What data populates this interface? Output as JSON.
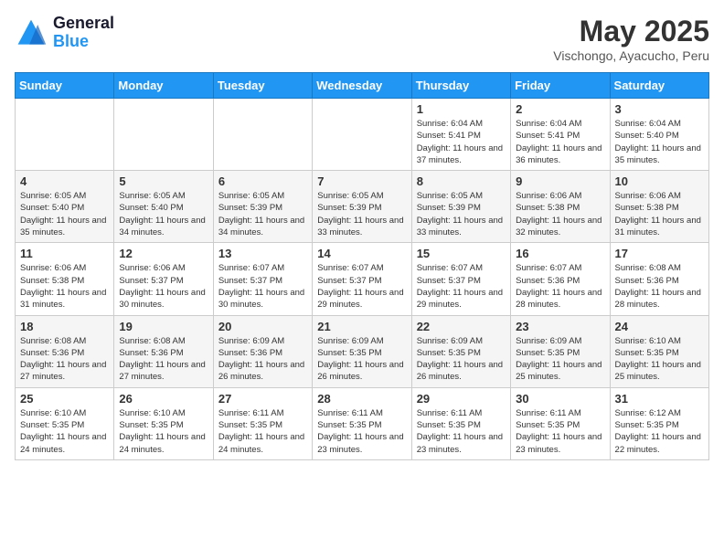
{
  "logo": {
    "text_general": "General",
    "text_blue": "Blue"
  },
  "title": "May 2025",
  "subtitle": "Vischongo, Ayacucho, Peru",
  "days_of_week": [
    "Sunday",
    "Monday",
    "Tuesday",
    "Wednesday",
    "Thursday",
    "Friday",
    "Saturday"
  ],
  "weeks": [
    [
      {
        "day": "",
        "info": ""
      },
      {
        "day": "",
        "info": ""
      },
      {
        "day": "",
        "info": ""
      },
      {
        "day": "",
        "info": ""
      },
      {
        "day": "1",
        "info": "Sunrise: 6:04 AM\nSunset: 5:41 PM\nDaylight: 11 hours and 37 minutes."
      },
      {
        "day": "2",
        "info": "Sunrise: 6:04 AM\nSunset: 5:41 PM\nDaylight: 11 hours and 36 minutes."
      },
      {
        "day": "3",
        "info": "Sunrise: 6:04 AM\nSunset: 5:40 PM\nDaylight: 11 hours and 35 minutes."
      }
    ],
    [
      {
        "day": "4",
        "info": "Sunrise: 6:05 AM\nSunset: 5:40 PM\nDaylight: 11 hours and 35 minutes."
      },
      {
        "day": "5",
        "info": "Sunrise: 6:05 AM\nSunset: 5:40 PM\nDaylight: 11 hours and 34 minutes."
      },
      {
        "day": "6",
        "info": "Sunrise: 6:05 AM\nSunset: 5:39 PM\nDaylight: 11 hours and 34 minutes."
      },
      {
        "day": "7",
        "info": "Sunrise: 6:05 AM\nSunset: 5:39 PM\nDaylight: 11 hours and 33 minutes."
      },
      {
        "day": "8",
        "info": "Sunrise: 6:05 AM\nSunset: 5:39 PM\nDaylight: 11 hours and 33 minutes."
      },
      {
        "day": "9",
        "info": "Sunrise: 6:06 AM\nSunset: 5:38 PM\nDaylight: 11 hours and 32 minutes."
      },
      {
        "day": "10",
        "info": "Sunrise: 6:06 AM\nSunset: 5:38 PM\nDaylight: 11 hours and 31 minutes."
      }
    ],
    [
      {
        "day": "11",
        "info": "Sunrise: 6:06 AM\nSunset: 5:38 PM\nDaylight: 11 hours and 31 minutes."
      },
      {
        "day": "12",
        "info": "Sunrise: 6:06 AM\nSunset: 5:37 PM\nDaylight: 11 hours and 30 minutes."
      },
      {
        "day": "13",
        "info": "Sunrise: 6:07 AM\nSunset: 5:37 PM\nDaylight: 11 hours and 30 minutes."
      },
      {
        "day": "14",
        "info": "Sunrise: 6:07 AM\nSunset: 5:37 PM\nDaylight: 11 hours and 29 minutes."
      },
      {
        "day": "15",
        "info": "Sunrise: 6:07 AM\nSunset: 5:37 PM\nDaylight: 11 hours and 29 minutes."
      },
      {
        "day": "16",
        "info": "Sunrise: 6:07 AM\nSunset: 5:36 PM\nDaylight: 11 hours and 28 minutes."
      },
      {
        "day": "17",
        "info": "Sunrise: 6:08 AM\nSunset: 5:36 PM\nDaylight: 11 hours and 28 minutes."
      }
    ],
    [
      {
        "day": "18",
        "info": "Sunrise: 6:08 AM\nSunset: 5:36 PM\nDaylight: 11 hours and 27 minutes."
      },
      {
        "day": "19",
        "info": "Sunrise: 6:08 AM\nSunset: 5:36 PM\nDaylight: 11 hours and 27 minutes."
      },
      {
        "day": "20",
        "info": "Sunrise: 6:09 AM\nSunset: 5:36 PM\nDaylight: 11 hours and 26 minutes."
      },
      {
        "day": "21",
        "info": "Sunrise: 6:09 AM\nSunset: 5:35 PM\nDaylight: 11 hours and 26 minutes."
      },
      {
        "day": "22",
        "info": "Sunrise: 6:09 AM\nSunset: 5:35 PM\nDaylight: 11 hours and 26 minutes."
      },
      {
        "day": "23",
        "info": "Sunrise: 6:09 AM\nSunset: 5:35 PM\nDaylight: 11 hours and 25 minutes."
      },
      {
        "day": "24",
        "info": "Sunrise: 6:10 AM\nSunset: 5:35 PM\nDaylight: 11 hours and 25 minutes."
      }
    ],
    [
      {
        "day": "25",
        "info": "Sunrise: 6:10 AM\nSunset: 5:35 PM\nDaylight: 11 hours and 24 minutes."
      },
      {
        "day": "26",
        "info": "Sunrise: 6:10 AM\nSunset: 5:35 PM\nDaylight: 11 hours and 24 minutes."
      },
      {
        "day": "27",
        "info": "Sunrise: 6:11 AM\nSunset: 5:35 PM\nDaylight: 11 hours and 24 minutes."
      },
      {
        "day": "28",
        "info": "Sunrise: 6:11 AM\nSunset: 5:35 PM\nDaylight: 11 hours and 23 minutes."
      },
      {
        "day": "29",
        "info": "Sunrise: 6:11 AM\nSunset: 5:35 PM\nDaylight: 11 hours and 23 minutes."
      },
      {
        "day": "30",
        "info": "Sunrise: 6:11 AM\nSunset: 5:35 PM\nDaylight: 11 hours and 23 minutes."
      },
      {
        "day": "31",
        "info": "Sunrise: 6:12 AM\nSunset: 5:35 PM\nDaylight: 11 hours and 22 minutes."
      }
    ]
  ]
}
